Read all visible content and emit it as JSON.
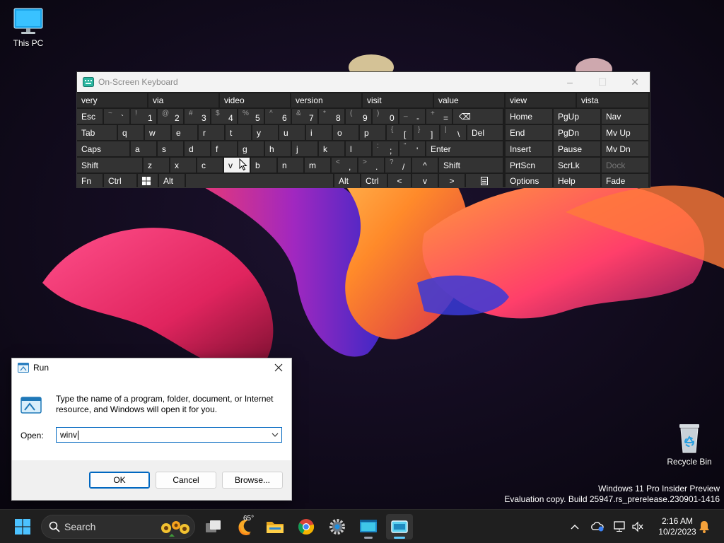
{
  "desktop": {
    "icons": [
      {
        "label": "This PC",
        "icon": "monitor-icon"
      },
      {
        "label": "Recycle Bin",
        "icon": "recycle-bin-icon"
      }
    ],
    "watermark": {
      "line1": "Windows 11 Pro Insider Preview",
      "line2": "Evaluation copy. Build 25947.rs_prerelease.230901-1416"
    }
  },
  "osk": {
    "title": "On-Screen Keyboard",
    "window_controls": {
      "minimize": "–",
      "maximize": "☐",
      "close": "✕"
    },
    "predictions": [
      "very",
      "via",
      "video",
      "version",
      "visit",
      "value",
      "view",
      "vista"
    ],
    "keys": {
      "esc": "Esc",
      "backspace": "⌫",
      "tab": "Tab",
      "del": "Del",
      "caps": "Caps",
      "enter": "Enter",
      "shift": "Shift",
      "fn": "Fn",
      "ctrl": "Ctrl",
      "alt": "Alt",
      "number_row": [
        {
          "sec": "~",
          "pri": "`"
        },
        {
          "sec": "!",
          "pri": "1"
        },
        {
          "sec": "@",
          "pri": "2"
        },
        {
          "sec": "#",
          "pri": "3"
        },
        {
          "sec": "$",
          "pri": "4"
        },
        {
          "sec": "%",
          "pri": "5"
        },
        {
          "sec": "^",
          "pri": "6"
        },
        {
          "sec": "&",
          "pri": "7"
        },
        {
          "sec": "*",
          "pri": "8"
        },
        {
          "sec": "(",
          "pri": "9"
        },
        {
          "sec": ")",
          "pri": "0"
        },
        {
          "sec": "_",
          "pri": "-"
        },
        {
          "sec": "+",
          "pri": "="
        }
      ],
      "qrow": [
        "q",
        "w",
        "e",
        "r",
        "t",
        "y",
        "u",
        "i",
        "o",
        "p"
      ],
      "qrow_sym": [
        {
          "sec": "{",
          "pri": "["
        },
        {
          "sec": "}",
          "pri": "]"
        },
        {
          "sec": "|",
          "pri": "\\"
        }
      ],
      "arow": [
        "a",
        "s",
        "d",
        "f",
        "g",
        "h",
        "j",
        "k",
        "l"
      ],
      "arow_sym": [
        {
          "sec": ":",
          "pri": ";"
        },
        {
          "sec": "\"",
          "pri": "'"
        }
      ],
      "zrow": [
        "z",
        "x",
        "c",
        "v",
        "b",
        "n",
        "m"
      ],
      "zrow_sym": [
        {
          "sec": "<",
          "pri": ","
        },
        {
          "sec": ">",
          "pri": "."
        },
        {
          "sec": "?",
          "pri": "/"
        }
      ],
      "pressed_key": "v",
      "arrows": {
        "up": "^",
        "left": "<",
        "down": "v",
        "right": ">"
      },
      "nav_cluster": [
        [
          "Home",
          "PgUp",
          "Nav"
        ],
        [
          "End",
          "PgDn",
          "Mv Up"
        ],
        [
          "Insert",
          "Pause",
          "Mv Dn"
        ],
        [
          "PrtScn",
          "ScrLk",
          "Dock"
        ],
        [
          "Options",
          "Help",
          "Fade"
        ]
      ]
    }
  },
  "run": {
    "title": "Run",
    "description": "Type the name of a program, folder, document, or Internet resource, and Windows will open it for you.",
    "open_label": "Open:",
    "input_value": "winv",
    "buttons": {
      "ok": "OK",
      "cancel": "Cancel",
      "browse": "Browse..."
    }
  },
  "taskbar": {
    "search_label": "Search",
    "weather_temp": "65°",
    "clock_time": "2:16 AM",
    "clock_date": "10/2/2023",
    "accent": "#60cdff"
  }
}
